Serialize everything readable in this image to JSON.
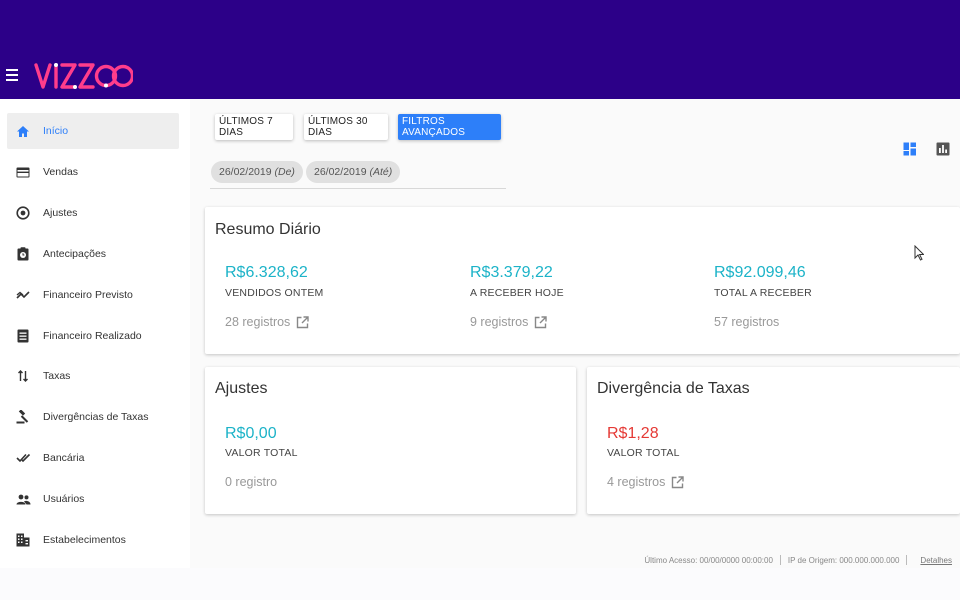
{
  "brand": {
    "name": "VIZZOO",
    "colors": {
      "header": "#2c0088",
      "accent": "#2d7ff9",
      "value": "#1cb3c8",
      "negative": "#e53935",
      "logo_pink": "#ff3d8b"
    }
  },
  "sidebar": {
    "items": [
      {
        "label": "Início",
        "icon": "home-icon",
        "active": true
      },
      {
        "label": "Vendas",
        "icon": "credit-card-icon"
      },
      {
        "label": "Ajustes",
        "icon": "target-icon"
      },
      {
        "label": "Antecipações",
        "icon": "clipboard-clock-icon"
      },
      {
        "label": "Financeiro Previsto",
        "icon": "trending-icon"
      },
      {
        "label": "Financeiro Realizado",
        "icon": "receipt-icon"
      },
      {
        "label": "Taxas",
        "icon": "swap-vertical-icon"
      },
      {
        "label": "Divergências de Taxas",
        "icon": "gavel-icon"
      },
      {
        "label": "Bancária",
        "icon": "double-check-icon"
      },
      {
        "label": "Usuários",
        "icon": "people-icon"
      },
      {
        "label": "Estabelecimentos",
        "icon": "building-icon"
      }
    ]
  },
  "filters": {
    "last7": "ÚLTIMOS 7 DIAS",
    "last30": "ÚLTIMOS 30 DIAS",
    "advanced": "FILTROS AVANÇADOS",
    "date_from": "26/02/2019",
    "date_from_suffix": "(De)",
    "date_to": "26/02/2019",
    "date_to_suffix": "(Até)"
  },
  "views": {
    "dashboard_icon": "dashboard-icon",
    "chart_icon": "bar-chart-icon"
  },
  "resumo": {
    "title": "Resumo Diário",
    "items": [
      {
        "value": "R$6.328,62",
        "label": "VENDIDOS ONTEM",
        "registros": "28 registros",
        "link": true
      },
      {
        "value": "R$3.379,22",
        "label": "A RECEBER HOJE",
        "registros": "9 registros",
        "link": true
      },
      {
        "value": "R$92.099,46",
        "label": "TOTAL A RECEBER",
        "registros": "57 registros",
        "link": false
      }
    ]
  },
  "ajustes": {
    "title": "Ajustes",
    "value": "R$0,00",
    "label": "VALOR TOTAL",
    "registros": "0 registro"
  },
  "divergencia": {
    "title": "Divergência de Taxas",
    "value": "R$1,28",
    "label": "VALOR TOTAL",
    "registros": "4 registros"
  },
  "footer": {
    "last_access": "Último Acesso: 00/00/0000 00:00:00",
    "origin_ip": "IP de Origem: 000.000.000.000",
    "details": "Detalhes"
  }
}
